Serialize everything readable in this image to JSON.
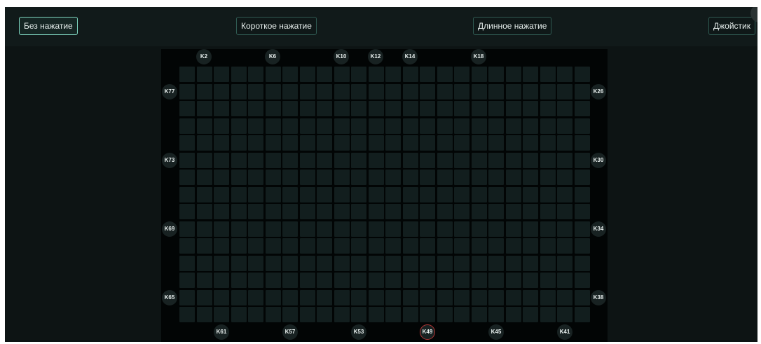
{
  "toolbar": {
    "buttons": [
      {
        "label": "Без нажатие",
        "active": true
      },
      {
        "label": "Короткое нажатие",
        "active": false
      },
      {
        "label": "Длинное нажатие",
        "active": false
      },
      {
        "label": "Джойстик",
        "active": false
      }
    ]
  },
  "grid": {
    "rows": 15,
    "cols": 24
  },
  "sensors": {
    "top": [
      "K2",
      "K6",
      "K10",
      "K12",
      "K14",
      "K18"
    ],
    "left": [
      "K77",
      "K73",
      "K69",
      "K65"
    ],
    "right": [
      "K26",
      "K30",
      "K34",
      "K38"
    ],
    "bottom": [
      "K61",
      "K57",
      "K53",
      "K49",
      "K45",
      "K41"
    ],
    "highlighted": "K49"
  },
  "colors": {
    "background": "#0d1414",
    "panel": "#020505",
    "cell": "#121e1e",
    "active_border": "#7fd6c0",
    "highlight_ring": "#b03434"
  }
}
